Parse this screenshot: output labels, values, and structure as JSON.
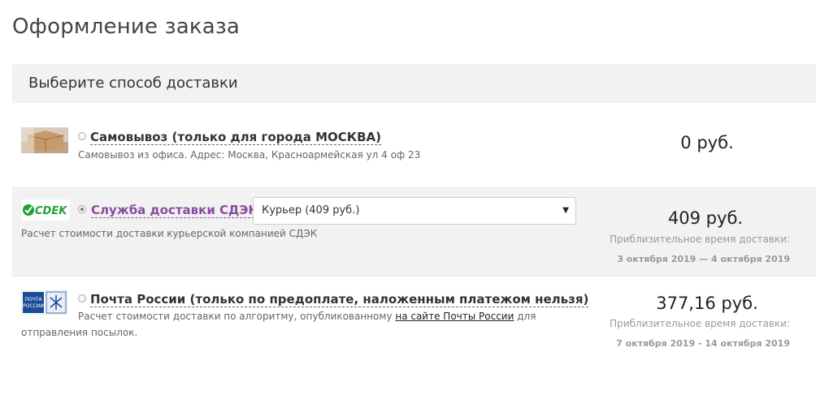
{
  "page": {
    "title": "Оформление заказа"
  },
  "section": {
    "title": "Выберите способ доставки"
  },
  "options": [
    {
      "id": "pickup",
      "name": "Самовывоз (только для города МОСКВА)",
      "description": "Самовывоз из офиса. Адрес: Москва, Красноармейская ул 4 оф 23",
      "price": "0 руб.",
      "selected": false
    },
    {
      "id": "cdek",
      "logo_text": "CDEK",
      "name": "Служба доставки СДЭК",
      "select_value": "Курьер (409 руб.)",
      "description": "Расчет стоимости доставки курьерской компанией СДЭК",
      "price": "409 руб.",
      "eta_label": "Приблизительное время доставки:",
      "eta_value": "3 октября 2019 — 4 октября 2019",
      "selected": true
    },
    {
      "id": "russianpost",
      "logo_text_line1": "ПОЧТА",
      "logo_text_line2": "РОССИИ",
      "name": "Почта России (только по предоплате, наложенным платежом нельзя)",
      "description_before": "Расчет стоимости доставки по алгоритму, опубликованному ",
      "description_link": "на сайте Почты России",
      "description_after": " для отправления посылок.",
      "price": "377,16 руб.",
      "eta_label": "Приблизительное время доставки:",
      "eta_value": "7 октября 2019 - 14 октября 2019",
      "selected": false
    }
  ],
  "colors": {
    "accent_purple": "#8a4d9e",
    "cdek_green": "#1fa332",
    "post_blue": "#1a4c97"
  }
}
